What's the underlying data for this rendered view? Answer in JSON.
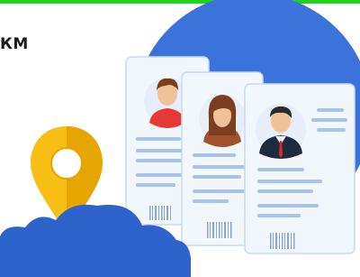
{
  "header": {
    "cropped_text": "КМ"
  },
  "illustration": {
    "icons": [
      "map-pin-icon",
      "cloud-icon",
      "person-icon"
    ],
    "colors": {
      "topbar": "#1fd41b",
      "circle": "#3b73db",
      "cloud": "#2f63cc",
      "pin": "#f7be16",
      "card": "#f2f7fd",
      "lines": "#a9c3ea"
    }
  }
}
